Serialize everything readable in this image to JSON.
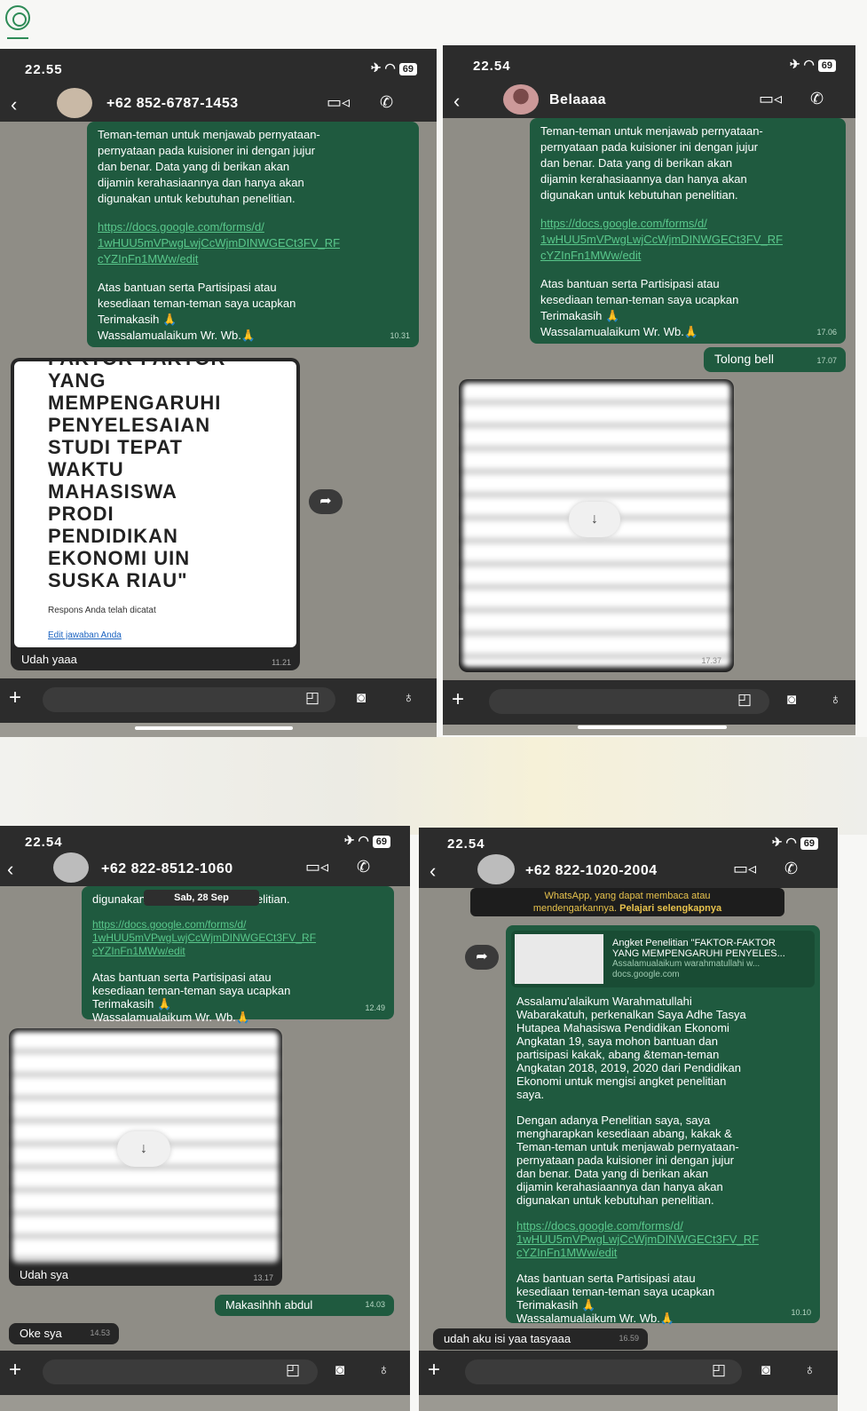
{
  "panels": {
    "p1": {
      "time": "22.55",
      "battery": "69",
      "contact": "+62 852-6787-1453",
      "msg_p1": "Teman-teman untuk menjawab pernyataan-\npernyataan pada kuisioner ini dengan jujur\ndan benar.  Data yang di berikan akan\ndijamin kerahasiaannya dan hanya akan\ndigunakan untuk kebutuhan penelitian.",
      "link": "https://docs.google.com/forms/d/\n1wHUU5mVPwgLwjCcWjmDINWGECt3FV_RF\ncYZInFn1MWw/edit",
      "msg_p3": "Atas bantuan serta Partisipasi atau\nkesediaan teman-teman saya ucapkan\nTerimakasih 🙏\nWassalamualaikum Wr. Wb.🙏",
      "msg_time": "10.31",
      "doc_title": "FAKTOR-FAKTOR\nYANG\nMEMPENGARUHI\nPENYELESAIAN\nSTUDI TEPAT\nWAKTU\nMAHASISWA\nPRODI\nPENDIDIKAN\nEKONOMI UIN\nSUSKA RIAU\"",
      "doc_resp": "Respons Anda telah dicatat",
      "doc_edit": "Edit jawaban Anda",
      "reply": "Udah yaaa",
      "reply_time": "11.21"
    },
    "p2": {
      "time": "22.54",
      "battery": "69",
      "contact": "Belaaaa",
      "msg_p1": "Teman-teman untuk menjawab pernyataan-\npernyataan pada kuisioner ini dengan jujur\ndan benar.  Data yang di berikan akan\ndijamin kerahasiaannya dan hanya akan\ndigunakan untuk kebutuhan penelitian.",
      "link": "https://docs.google.com/forms/d/\n1wHUU5mVPwgLwjCcWjmDINWGECt3FV_RF\ncYZInFn1MWw/edit",
      "msg_p3": "Atas bantuan serta Partisipasi atau\nkesediaan teman-teman saya ucapkan\nTerimakasih 🙏\nWassalamualaikum Wr. Wb.🙏",
      "msg_time": "17.06",
      "out2": "Tolong bell",
      "out2_time": "17.07",
      "img_time": "17.37"
    },
    "p3": {
      "time": "22.54",
      "battery": "69",
      "contact": "+62 822-8512-1060",
      "date_sep": "Sab, 28 Sep",
      "msg_p0": "digunakan untuk kebutuhan penelitian.",
      "link": "https://docs.google.com/forms/d/\n1wHUU5mVPwgLwjCcWjmDINWGECt3FV_RF\ncYZInFn1MWw/edit",
      "msg_p3": "Atas bantuan serta Partisipasi atau\nkesediaan teman-teman saya ucapkan\nTerimakasih 🙏\nWassalamualaikum Wr. Wb.🙏",
      "msg_time": "12.49",
      "reply": "Udah sya",
      "reply_time": "13.17",
      "out2": "Makasihhh abdul",
      "out2_time": "14.03",
      "in3": "Oke sya",
      "in3_time": "14.53"
    },
    "p4": {
      "time": "22.54",
      "battery": "69",
      "contact": "+62 822-1020-2004",
      "notice": "WhatsApp, yang dapat membaca atau\nmendengarkannya.",
      "notice_link": "Pelajari selengkapnya",
      "prev_title": "Angket Penelitian \"FAKTOR-FAKTOR\nYANG MEMPENGARUHI PENYELES...",
      "prev_desc": "Assalamualaikum warahmatullahi w...",
      "prev_domain": "docs.google.com",
      "msg_p1": "Assalamu'alaikum Warahmatullahi\nWabarakatuh, perkenalkan Saya Adhe Tasya\nHutapea Mahasiswa Pendidikan Ekonomi\nAngkatan 19, saya mohon bantuan dan\npartisipasi kakak, abang &teman-teman\nAngkatan 2018, 2019, 2020 dari Pendidikan\nEkonomi untuk mengisi angket penelitian\nsaya.",
      "msg_p2": "Dengan adanya Penelitian saya, saya\nmengharapkan kesediaan abang, kakak &\nTeman-teman untuk menjawab pernyataan-\npernyataan pada kuisioner ini dengan jujur\ndan benar.  Data yang di berikan akan\ndijamin kerahasiaannya dan hanya akan\ndigunakan untuk kebutuhan penelitian.",
      "link": "https://docs.google.com/forms/d/\n1wHUU5mVPwgLwjCcWjmDINWGECt3FV_RF\ncYZInFn1MWw/edit",
      "msg_p3": "Atas bantuan serta Partisipasi atau\nkesediaan teman-teman saya ucapkan\nTerimakasih 🙏\nWassalamualaikum Wr. Wb.🙏",
      "msg_time": "10.10",
      "reply": "udah aku isi yaa tasyaaa",
      "reply_time": "16.59"
    }
  },
  "icons": {
    "back": "chevron-left-icon",
    "video": "video-camera-icon",
    "call": "phone-icon",
    "plus": "plus-icon",
    "sticker": "sticker-icon",
    "camera": "camera-icon",
    "mic": "microphone-icon",
    "forward": "forward-icon",
    "download": "download-icon",
    "airplane": "airplane-mode-icon",
    "wifi": "wifi-icon"
  },
  "colors": {
    "header": "#2c2c2c",
    "outgoing_bubble": "#1f5a3f",
    "incoming_bubble": "#262626",
    "link": "#59c78b",
    "chat_bg": "#8f8d86"
  }
}
